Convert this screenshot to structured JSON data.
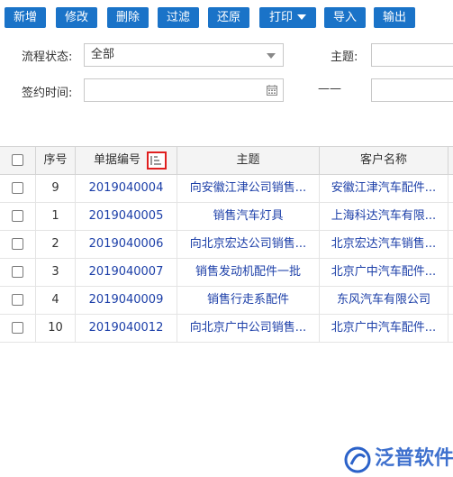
{
  "toolbar": {
    "buttons": [
      {
        "label": "新增"
      },
      {
        "label": "修改"
      },
      {
        "label": "删除"
      },
      {
        "label": "过滤"
      },
      {
        "label": "还原"
      },
      {
        "label": "打印"
      },
      {
        "label": "导入"
      },
      {
        "label": "输出"
      }
    ]
  },
  "filters": {
    "status_label": "流程状态:",
    "status_value": "全部",
    "topic_label": "主题:",
    "date_label": "签约时间:",
    "date_separator": "——"
  },
  "table": {
    "headers": {
      "seq": "序号",
      "number": "单据编号",
      "topic": "主题",
      "customer": "客户名称"
    },
    "rows": [
      {
        "seq": "9",
        "number": "2019040004",
        "topic": "向安徽江津公司销售...",
        "customer": "安徽江津汽车配件..."
      },
      {
        "seq": "1",
        "number": "2019040005",
        "topic": "销售汽车灯具",
        "customer": "上海科达汽车有限..."
      },
      {
        "seq": "2",
        "number": "2019040006",
        "topic": "向北京宏达公司销售...",
        "customer": "北京宏达汽车销售..."
      },
      {
        "seq": "3",
        "number": "2019040007",
        "topic": "销售发动机配件一批",
        "customer": "北京广中汽车配件..."
      },
      {
        "seq": "4",
        "number": "2019040009",
        "topic": "销售行走系配件",
        "customer": "东风汽车有限公司"
      },
      {
        "seq": "10",
        "number": "2019040012",
        "topic": "向北京广中公司销售...",
        "customer": "北京广中汽车配件..."
      }
    ]
  },
  "watermark": {
    "text": "泛普软件"
  },
  "colors": {
    "toolbar_button": "#1a73c8",
    "link": "#1c3fa8",
    "sort_highlight": "#e02020"
  }
}
